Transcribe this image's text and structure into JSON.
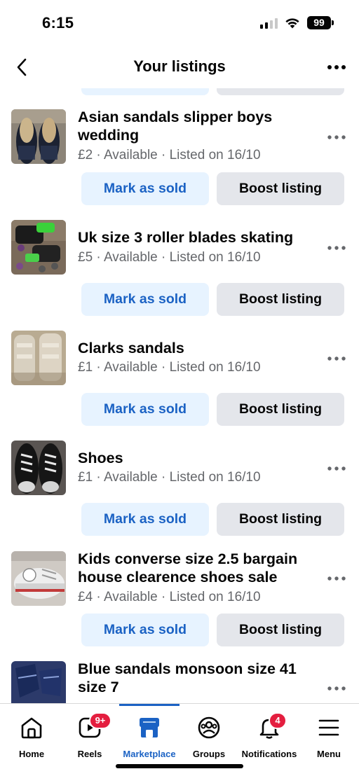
{
  "status_bar": {
    "time": "6:15",
    "battery": "99",
    "icons": [
      "signal-icon",
      "wifi-icon",
      "battery-icon"
    ]
  },
  "header": {
    "title": "Your listings",
    "back_icon": "chevron-left-icon",
    "more_icon": "more-horizontal-icon"
  },
  "listings": [
    {
      "title": "Asian sandals slipper boys wedding",
      "meta": "£2 · Available · Listed on 16/10",
      "mark_sold_label": "Mark as sold",
      "boost_label": "Boost listing"
    },
    {
      "title": "Uk size 3 roller blades skating",
      "meta": "£5 · Available · Listed on 16/10",
      "mark_sold_label": "Mark as sold",
      "boost_label": "Boost listing"
    },
    {
      "title": "Clarks sandals",
      "meta": "£1 · Available · Listed on 16/10",
      "mark_sold_label": "Mark as sold",
      "boost_label": "Boost listing"
    },
    {
      "title": "Shoes",
      "meta": "£1 · Available · Listed on 16/10",
      "mark_sold_label": "Mark as sold",
      "boost_label": "Boost listing"
    },
    {
      "title": "Kids converse size 2.5 bargain house clearence shoes sale",
      "meta": "£4 · Available · Listed on 16/10",
      "mark_sold_label": "Mark as sold",
      "boost_label": "Boost listing"
    },
    {
      "title": "Blue sandals monsoon  size 41 size 7",
      "meta": "",
      "mark_sold_label": "",
      "boost_label": ""
    }
  ],
  "bottom_nav": {
    "items": [
      {
        "label": "Home",
        "icon": "home-icon"
      },
      {
        "label": "Reels",
        "icon": "reels-icon",
        "badge": "9+"
      },
      {
        "label": "Marketplace",
        "icon": "marketplace-icon",
        "active": true
      },
      {
        "label": "Groups",
        "icon": "groups-icon"
      },
      {
        "label": "Notifications",
        "icon": "bell-icon",
        "badge": "4"
      },
      {
        "label": "Menu",
        "icon": "menu-icon"
      }
    ]
  },
  "colors": {
    "accent": "#1b62c4",
    "sold_button_bg": "#e7f3ff",
    "boost_button_bg": "#e4e6eb",
    "secondary_text": "#65676b",
    "badge": "#e41e3f"
  }
}
